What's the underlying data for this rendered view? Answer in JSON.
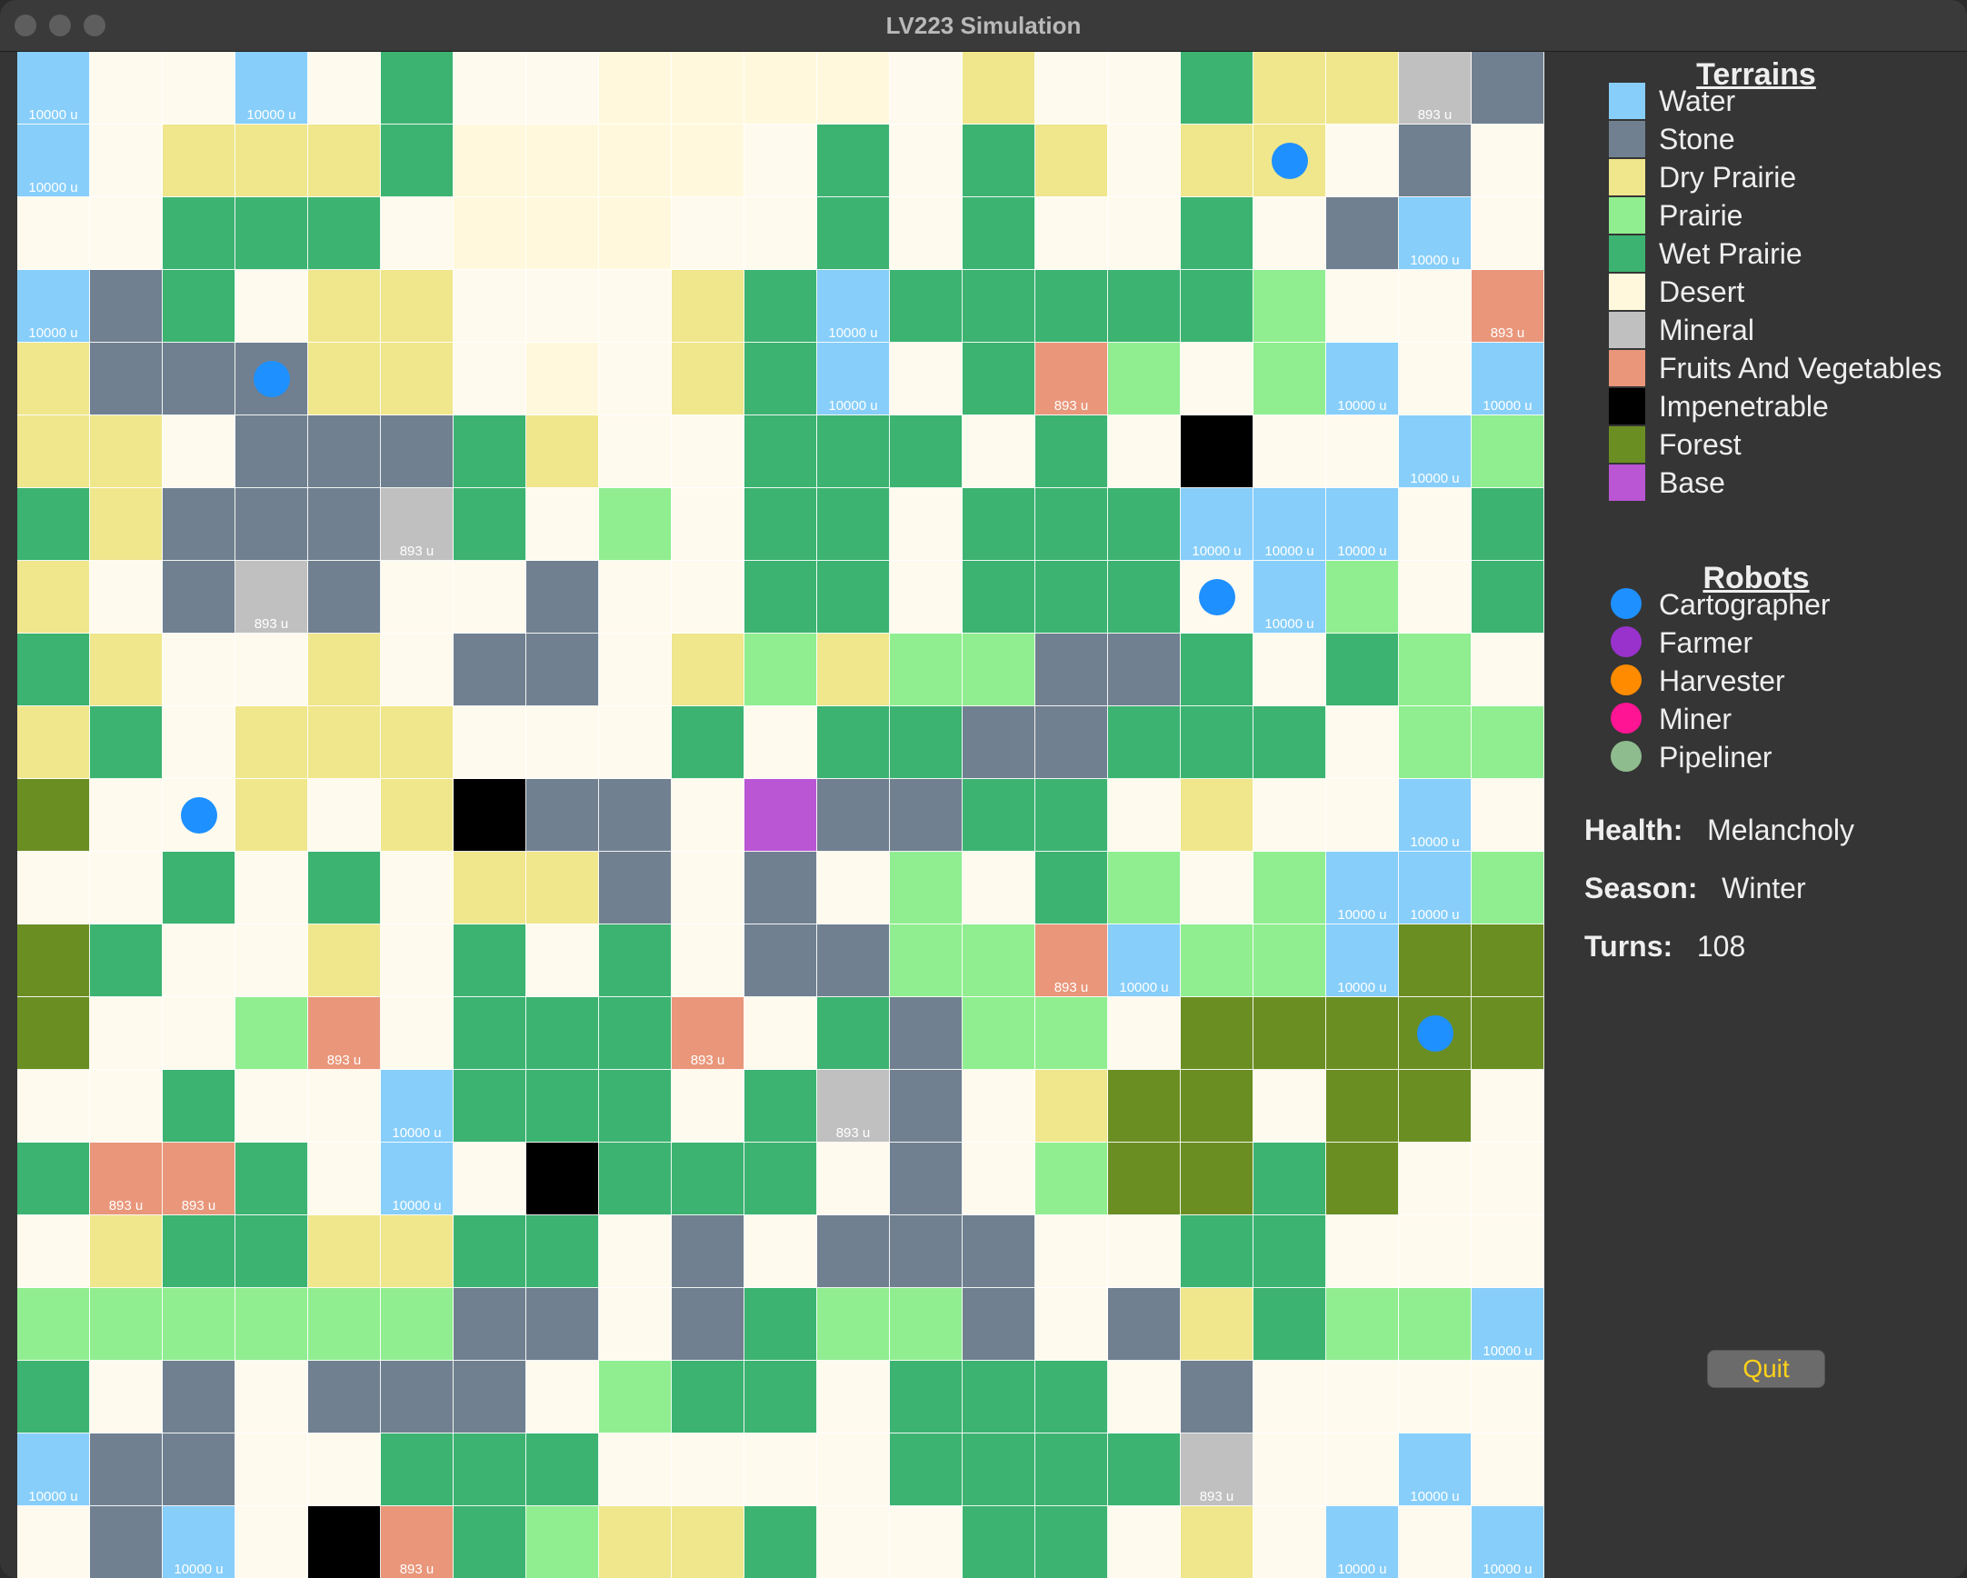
{
  "window": {
    "title": "LV223 Simulation"
  },
  "terrain_colors": {
    "water": "#87cefa",
    "stone": "#708090",
    "dry_prairie": "#f0e68c",
    "prairie": "#90ee90",
    "wet_prairie": "#3cb371",
    "desert": "#fffaee",
    "sand": "#fff8dc",
    "mineral": "#c0c0c0",
    "fruits": "#e9967a",
    "impenetrable": "#000000",
    "forest": "#6b8e23",
    "base": "#ba55d3"
  },
  "grid_codes": {
    "W": "water",
    "S": "stone",
    "Y": "dry_prairie",
    "P": "prairie",
    "G": "wet_prairie",
    "D": "desert",
    "C": "sand",
    "M": "mineral",
    "F": "fruits",
    "X": "impenetrable",
    "O": "forest",
    "B": "base"
  },
  "map": {
    "rows": [
      "WDDWDGDDCCCCDYDDGYYMS",
      "WDYYYGCCCCDGDGYDYYDSD",
      "DDGGGDCCCDDGDGDDGDSWD",
      "WSGDYYDDDYGWGGGGGPDDF",
      "YSSSYYDCDYGWDGFPDPWDW",
      "YYDSSSGYDDGGGDGDXDDWP",
      "GYSSSMGDPDGGDGGGWWWDG",
      "YDSMSDDSDDGGDGGGDWPDG",
      "GYDDYDSSDYPYPPSSGDGPD",
      "YGDYYYDDDGDGGSSGGGDPP",
      "ODDYDYXSSDBSSGGDYDDWD",
      "DDGDGDYYSDSDPDGPDPWWP",
      "OGDDYDGDGDSSPPFWPPWOO",
      "ODDPFDGGGFDGSPPDOOOOO",
      "DDGDDWGGGDGMSDYOODOOD",
      "GFFGDWDXGGGDSDPOOGODD",
      "DYGGYYGGDSDSSSDDGGDDD",
      "PPPPPPSSDSGPPSDSYGPPW",
      "GDSDSSSDPGGDGGGDSDDDD",
      "WSSDDGGGDDDDGGGGMDDWD",
      "DSWDXFGPYYGDDGGDYDWDW"
    ],
    "resources": [
      {
        "row": 0,
        "col": 0,
        "label": "10000 u"
      },
      {
        "row": 0,
        "col": 3,
        "label": "10000 u"
      },
      {
        "row": 0,
        "col": 19,
        "label": "893 u"
      },
      {
        "row": 1,
        "col": 0,
        "label": "10000 u"
      },
      {
        "row": 2,
        "col": 19,
        "label": "10000 u"
      },
      {
        "row": 3,
        "col": 0,
        "label": "10000 u"
      },
      {
        "row": 3,
        "col": 11,
        "label": "10000 u"
      },
      {
        "row": 3,
        "col": 20,
        "label": "893 u"
      },
      {
        "row": 4,
        "col": 11,
        "label": "10000 u"
      },
      {
        "row": 4,
        "col": 14,
        "label": "893 u"
      },
      {
        "row": 4,
        "col": 18,
        "label": "10000 u"
      },
      {
        "row": 4,
        "col": 20,
        "label": "10000 u"
      },
      {
        "row": 5,
        "col": 19,
        "label": "10000 u"
      },
      {
        "row": 6,
        "col": 5,
        "label": "893 u"
      },
      {
        "row": 6,
        "col": 16,
        "label": "10000 u"
      },
      {
        "row": 6,
        "col": 17,
        "label": "10000 u"
      },
      {
        "row": 6,
        "col": 18,
        "label": "10000 u"
      },
      {
        "row": 7,
        "col": 3,
        "label": "893 u"
      },
      {
        "row": 7,
        "col": 17,
        "label": "10000 u"
      },
      {
        "row": 10,
        "col": 19,
        "label": "10000 u"
      },
      {
        "row": 11,
        "col": 18,
        "label": "10000 u"
      },
      {
        "row": 11,
        "col": 19,
        "label": "10000 u"
      },
      {
        "row": 12,
        "col": 14,
        "label": "893 u"
      },
      {
        "row": 12,
        "col": 15,
        "label": "10000 u"
      },
      {
        "row": 12,
        "col": 18,
        "label": "10000 u"
      },
      {
        "row": 13,
        "col": 4,
        "label": "893 u"
      },
      {
        "row": 13,
        "col": 9,
        "label": "893 u"
      },
      {
        "row": 14,
        "col": 5,
        "label": "10000 u"
      },
      {
        "row": 14,
        "col": 11,
        "label": "893 u"
      },
      {
        "row": 15,
        "col": 1,
        "label": "893 u"
      },
      {
        "row": 15,
        "col": 2,
        "label": "893 u"
      },
      {
        "row": 15,
        "col": 5,
        "label": "10000 u"
      },
      {
        "row": 17,
        "col": 20,
        "label": "10000 u"
      },
      {
        "row": 19,
        "col": 0,
        "label": "10000 u"
      },
      {
        "row": 19,
        "col": 16,
        "label": "893 u"
      },
      {
        "row": 19,
        "col": 19,
        "label": "10000 u"
      },
      {
        "row": 20,
        "col": 2,
        "label": "10000 u"
      },
      {
        "row": 20,
        "col": 5,
        "label": "893 u"
      },
      {
        "row": 20,
        "col": 18,
        "label": "10000 u"
      },
      {
        "row": 20,
        "col": 20,
        "label": "10000 u"
      }
    ],
    "robots": [
      {
        "row": 1,
        "col": 17,
        "type": "Cartographer"
      },
      {
        "row": 4,
        "col": 3,
        "type": "Cartographer"
      },
      {
        "row": 7,
        "col": 16,
        "type": "Cartographer"
      },
      {
        "row": 10,
        "col": 2,
        "type": "Cartographer"
      },
      {
        "row": 13,
        "col": 19,
        "type": "Cartographer"
      }
    ]
  },
  "legend": {
    "terrains_title": "Terrains",
    "terrains": [
      {
        "label": "Water",
        "color": "#87cefa"
      },
      {
        "label": "Stone",
        "color": "#708090"
      },
      {
        "label": "Dry Prairie",
        "color": "#f0e68c"
      },
      {
        "label": "Prairie",
        "color": "#90ee90"
      },
      {
        "label": "Wet Prairie",
        "color": "#3cb371"
      },
      {
        "label": "Desert",
        "color": "#fff8dc"
      },
      {
        "label": "Mineral",
        "color": "#c0c0c0"
      },
      {
        "label": "Fruits And Vegetables",
        "color": "#e9967a"
      },
      {
        "label": "Impenetrable",
        "color": "#000000"
      },
      {
        "label": "Forest",
        "color": "#6b8e23"
      },
      {
        "label": "Base",
        "color": "#ba55d3"
      }
    ],
    "robots_title": "Robots",
    "robots": [
      {
        "label": "Cartographer",
        "color": "#1e90ff"
      },
      {
        "label": "Farmer",
        "color": "#9932cc"
      },
      {
        "label": "Harvester",
        "color": "#ff8c00"
      },
      {
        "label": "Miner",
        "color": "#ff1493"
      },
      {
        "label": "Pipeliner",
        "color": "#8fbc8f"
      }
    ]
  },
  "status": {
    "health_label": "Health:",
    "health_value": "Melancholy",
    "season_label": "Season:",
    "season_value": "Winter",
    "turns_label": "Turns:",
    "turns_value": "108"
  },
  "quit_label": "Quit"
}
